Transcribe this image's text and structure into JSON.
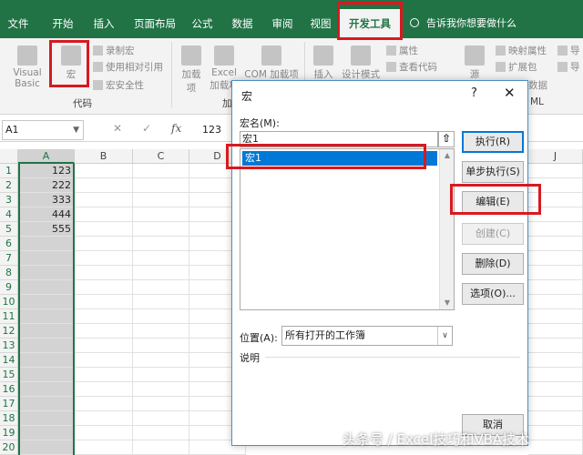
{
  "ribbon": {
    "tabs": [
      "文件",
      "开始",
      "插入",
      "页面布局",
      "公式",
      "数据",
      "审阅",
      "视图",
      "开发工具"
    ],
    "active_tab": "开发工具",
    "tell_me": "告诉我你想要做什么",
    "code_group": {
      "visual_basic": "Visual Basic",
      "macros": "宏",
      "record_macro": "录制宏",
      "relative_ref": "使用相对引用",
      "macro_security": "宏安全性",
      "label": "代码"
    },
    "addins_group": {
      "addins": "加载项",
      "excel_addins": "Excel 加载项",
      "com_addins": "COM 加载项",
      "label": "加"
    },
    "controls_group": {
      "insert": "插入",
      "design_mode": "设计模式",
      "properties": "属性",
      "view_code": "查看代码"
    },
    "xml_group": {
      "source": "源",
      "map_properties": "映射属性",
      "expansion_packs": "扩展包",
      "refresh_data": "数据",
      "import": "导",
      "export": "导",
      "label": "ML"
    }
  },
  "formula_bar": {
    "name_box": "A1",
    "cancel": "✕",
    "enter": "✓",
    "fx": "fx",
    "value": "123"
  },
  "grid": {
    "columns": [
      "A",
      "B",
      "C",
      "D",
      "J"
    ],
    "rows": [
      "1",
      "2",
      "3",
      "4",
      "5",
      "6",
      "7",
      "8",
      "9",
      "10",
      "11",
      "12",
      "13",
      "14",
      "15",
      "16",
      "17",
      "18",
      "19",
      "20"
    ],
    "column_a_values": [
      "123",
      "222",
      "333",
      "444",
      "555"
    ]
  },
  "dialog": {
    "title": "宏",
    "help": "?",
    "close": "✕",
    "macro_name_label": "宏名(M):",
    "macro_name_value": "宏1",
    "macro_list": [
      "宏1"
    ],
    "location_label": "位置(A):",
    "location_value": "所有打开的工作簿",
    "description_label": "说明",
    "buttons": {
      "run": "执行(R)",
      "step_into": "单步执行(S)",
      "edit": "编辑(E)",
      "create": "创建(C)",
      "delete": "删除(D)",
      "options": "选项(O)...",
      "cancel": "取消"
    }
  },
  "watermark": "头条号 / Excel技巧和VBA技术",
  "colors": {
    "excel_green": "#217346",
    "highlight_red": "#d8191f",
    "selection_blue": "#0078d7"
  }
}
